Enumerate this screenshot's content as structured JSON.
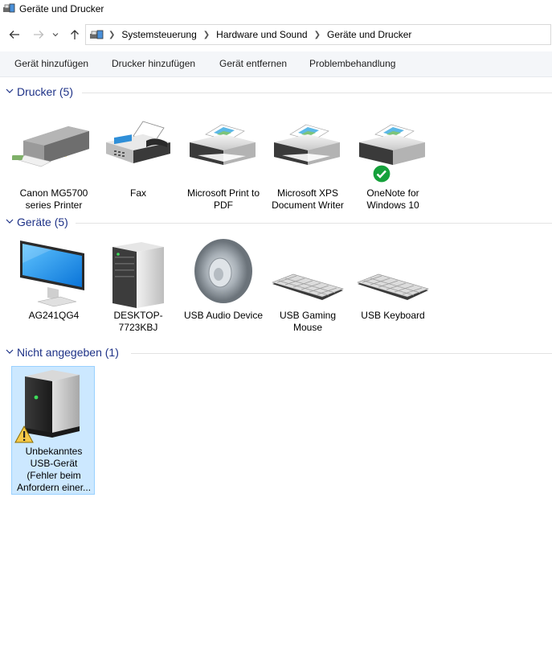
{
  "window": {
    "title": "Geräte und Drucker"
  },
  "breadcrumb": [
    {
      "label": "Systemsteuerung"
    },
    {
      "label": "Hardware und Sound"
    },
    {
      "label": "Geräte und Drucker"
    }
  ],
  "toolbar": {
    "add_device": "Gerät hinzufügen",
    "add_printer": "Drucker hinzufügen",
    "remove_device": "Gerät entfernen",
    "troubleshoot": "Problembehandlung"
  },
  "groups": {
    "printers": {
      "title": "Drucker (5)",
      "items": [
        {
          "label": "Canon MG5700 series Printer",
          "icon": "inkjet-printer-icon"
        },
        {
          "label": "Fax",
          "icon": "fax-icon"
        },
        {
          "label": "Microsoft Print to PDF",
          "icon": "printer-icon"
        },
        {
          "label": "Microsoft XPS Document Writer",
          "icon": "printer-icon"
        },
        {
          "label": "OneNote for Windows 10",
          "icon": "printer-icon",
          "badge": "default-checkmark-icon"
        }
      ]
    },
    "devices": {
      "title": "Geräte (5)",
      "items": [
        {
          "label": "AG241QG4",
          "icon": "monitor-icon"
        },
        {
          "label": "DESKTOP-7723KBJ",
          "icon": "computer-tower-icon"
        },
        {
          "label": "USB Audio Device",
          "icon": "speaker-icon"
        },
        {
          "label": "USB Gaming Mouse",
          "icon": "keyboard-icon"
        },
        {
          "label": "USB Keyboard",
          "icon": "keyboard-icon"
        }
      ]
    },
    "unspecified": {
      "title": "Nicht angegeben (1)",
      "items": [
        {
          "label": "Unbekanntes USB-Gerät (Fehler beim Anfordern einer...",
          "icon": "usb-drive-icon",
          "badge": "warning-icon",
          "selected": true
        }
      ]
    }
  },
  "colors": {
    "group_title": "#1e3287",
    "selection_bg": "#cce8ff",
    "selection_border": "#99d1ff",
    "toolbar_bg": "#f4f6f9"
  }
}
